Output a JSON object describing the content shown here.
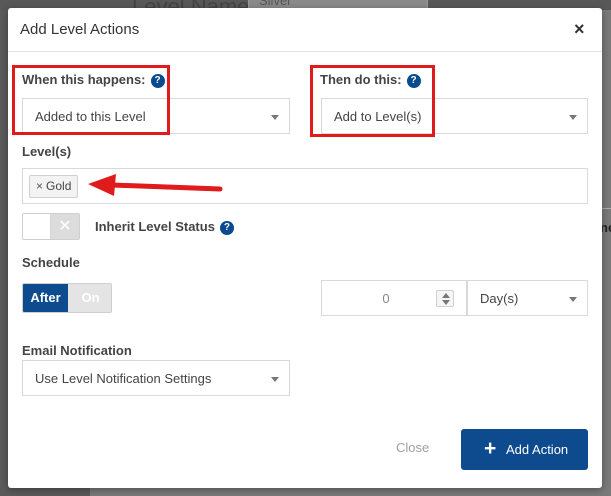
{
  "background": {
    "page_title": "Level Name",
    "name_value": "Silver",
    "right_heading": "ne"
  },
  "modal": {
    "title": "Add Level Actions",
    "close_symbol": "×"
  },
  "when": {
    "label": "When this happens:",
    "help_symbol": "?",
    "selected": "Added to this Level"
  },
  "then": {
    "label": "Then do this:",
    "help_symbol": "?",
    "selected": "Add to Level(s)"
  },
  "levels": {
    "label": "Level(s)",
    "tags": [
      {
        "remove_symbol": "×",
        "label": "Gold"
      }
    ]
  },
  "inherit": {
    "label": "Inherit Level Status",
    "help_symbol": "?",
    "toggle_off_symbol": "✕",
    "enabled": false
  },
  "schedule": {
    "label": "Schedule",
    "after_label": "After",
    "on_label": "On",
    "selected": "After",
    "amount": "0",
    "unit": "Day(s)"
  },
  "email": {
    "label": "Email Notification",
    "selected": "Use Level Notification Settings"
  },
  "footer": {
    "close_label": "Close",
    "add_label": "Add Action",
    "add_icon": "+"
  },
  "colors": {
    "primary": "#0d4b8e",
    "annotation": "#e01b1b"
  }
}
